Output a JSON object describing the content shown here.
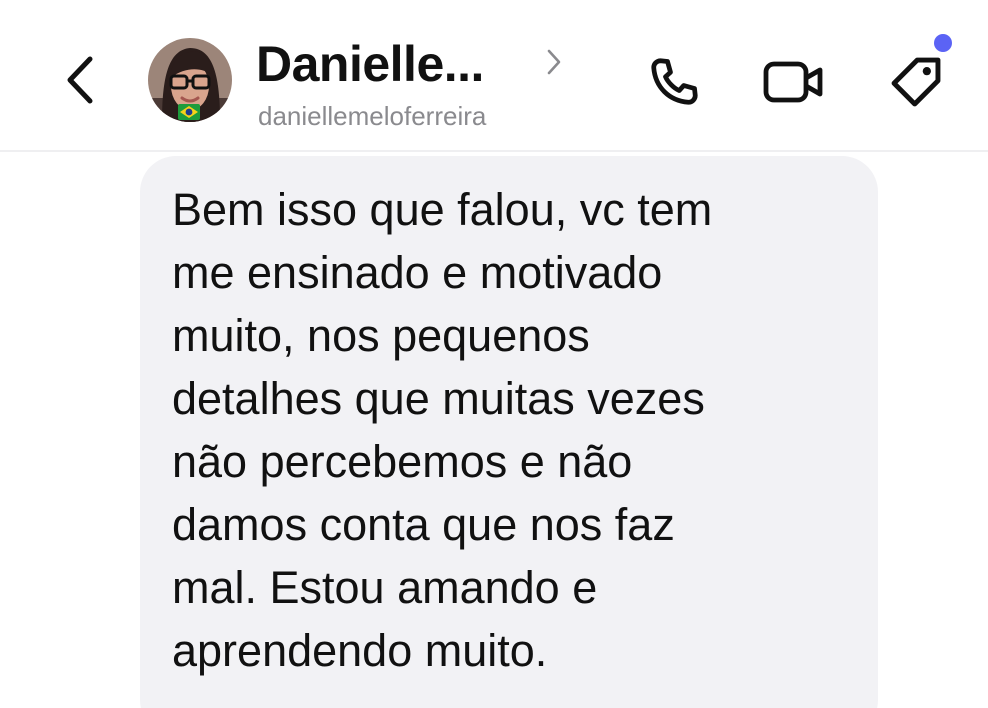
{
  "header": {
    "contact_name": "Danielle...",
    "contact_username": "daniellemeloferreira",
    "icons": {
      "back": "chevron-left-icon",
      "profile": "chevron-right-icon",
      "call": "phone-icon",
      "video": "video-camera-icon",
      "tag": "tag-icon"
    },
    "notification_dot_color": "#5b63f5"
  },
  "message": {
    "lines": [
      "Bem isso que falou, vc tem",
      "me ensinado e motivado",
      "muito, nos pequenos",
      "detalhes que muitas vezes",
      "não percebemos e não",
      "damos conta que nos faz",
      "mal. Estou amando e",
      "aprendendo muito."
    ],
    "bubble_color": "#f2f2f5"
  }
}
